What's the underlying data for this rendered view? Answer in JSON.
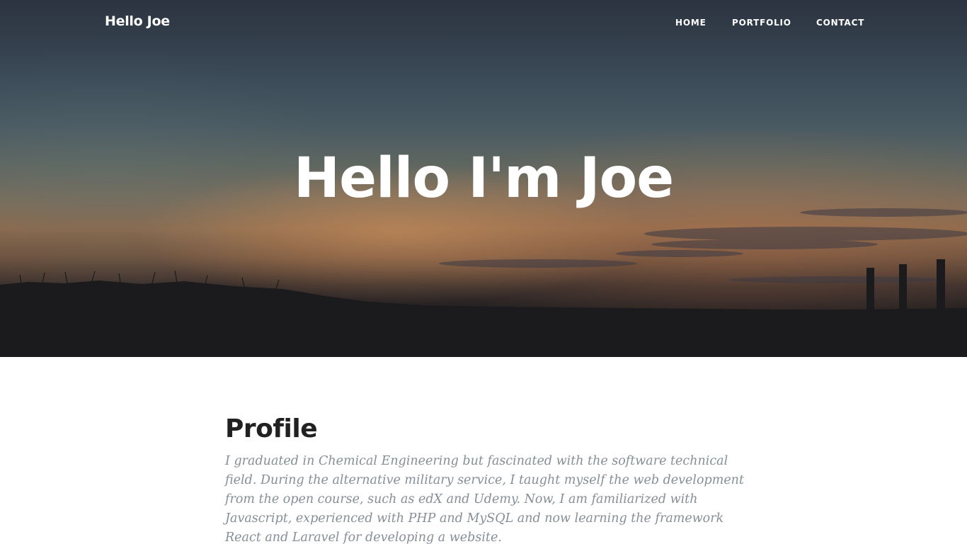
{
  "navbar": {
    "brand": "Hello Joe",
    "links": [
      "HOME",
      "PORTFOLIO",
      "CONTACT"
    ]
  },
  "hero": {
    "title": "Hello I'm Joe"
  },
  "profile": {
    "heading": "Profile",
    "text": "I graduated in Chemical Engineering but fascinated with the software technical field. During the alternative military service, I taught myself the web development from the open course, such as edX and Udemy. Now, I am familiarized with Javascript, experienced with PHP and MySQL and now learning the framework React and Laravel for developing a website."
  },
  "colors": {
    "nav_text": "#ffffff",
    "heading": "#212121",
    "body_text": "#868e96"
  }
}
